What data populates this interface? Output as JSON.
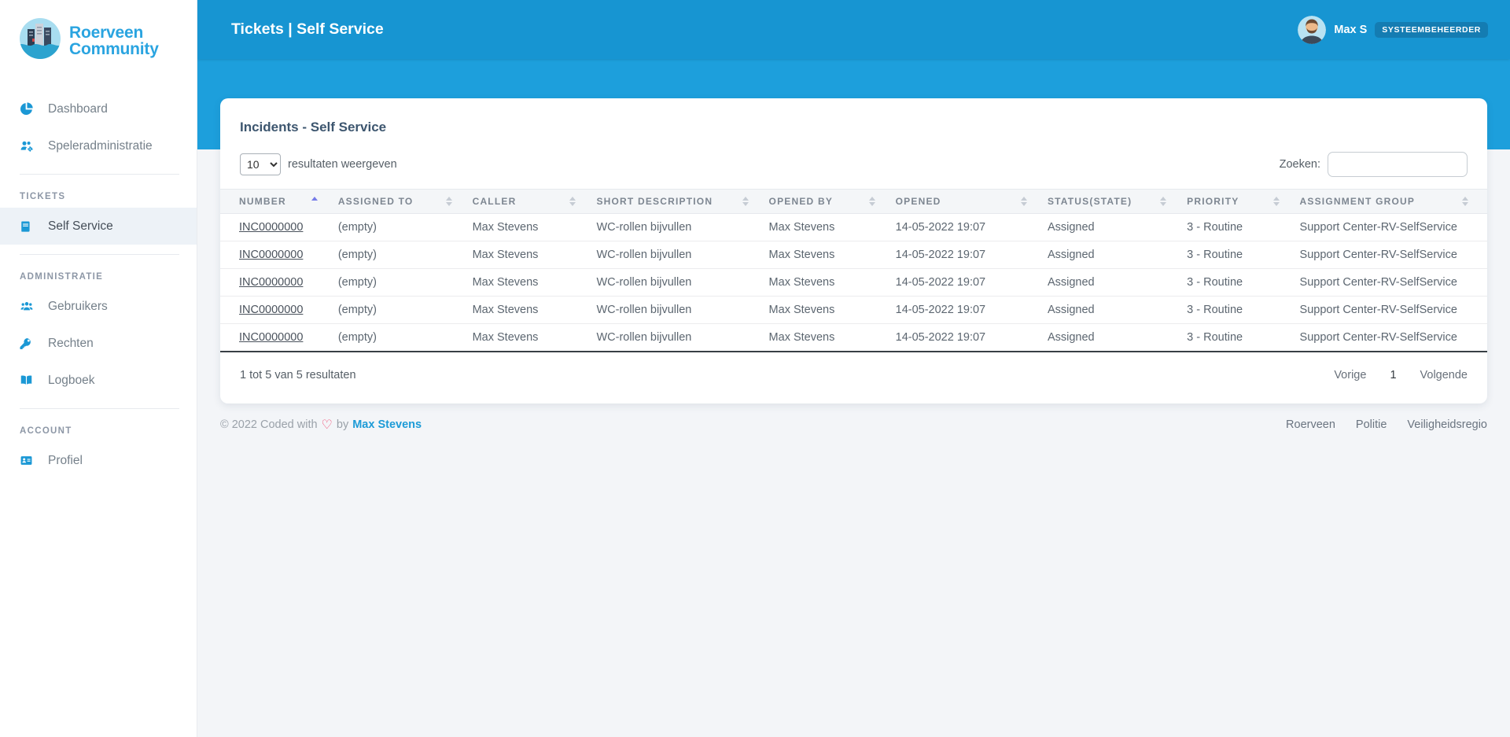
{
  "brand": {
    "line1": "Roerveen",
    "line2": "Community"
  },
  "topbar": {
    "title": "Tickets | Self Service",
    "user_name": "Max S",
    "user_role": "SYSTEEMBEHEERDER"
  },
  "sidebar": {
    "primary": [
      {
        "label": "Dashboard",
        "icon": "pie-chart-icon"
      },
      {
        "label": "Speleradministratie",
        "icon": "users-gear-icon"
      }
    ],
    "sections": [
      {
        "title": "TICKETS",
        "items": [
          {
            "label": "Self Service",
            "icon": "book-icon",
            "active": true
          }
        ]
      },
      {
        "title": "ADMINISTRATIE",
        "items": [
          {
            "label": "Gebruikers",
            "icon": "users-icon"
          },
          {
            "label": "Rechten",
            "icon": "key-icon"
          },
          {
            "label": "Logboek",
            "icon": "open-book-icon"
          }
        ]
      },
      {
        "title": "ACCOUNT",
        "items": [
          {
            "label": "Profiel",
            "icon": "id-card-icon"
          }
        ]
      }
    ]
  },
  "card": {
    "title": "Incidents - Self Service",
    "length_value": "10",
    "length_label": "resultaten weergeven",
    "search_label": "Zoeken:",
    "info": "1 tot 5 van 5 resultaten",
    "pagination": {
      "previous": "Vorige",
      "page": "1",
      "next": "Volgende"
    }
  },
  "table": {
    "keys": [
      "number",
      "assigned_to",
      "caller",
      "short_description",
      "opened_by",
      "opened",
      "status",
      "priority",
      "assignment_group"
    ],
    "columns": [
      {
        "label": "NUMBER",
        "sort": "asc"
      },
      {
        "label": "ASSIGNED TO",
        "sort": "both"
      },
      {
        "label": "CALLER",
        "sort": "both"
      },
      {
        "label": "SHORT DESCRIPTION",
        "sort": "both"
      },
      {
        "label": "OPENED BY",
        "sort": "both"
      },
      {
        "label": "OPENED",
        "sort": "both"
      },
      {
        "label": "STATUS(STATE)",
        "sort": "both"
      },
      {
        "label": "PRIORITY",
        "sort": "both"
      },
      {
        "label": "ASSIGNMENT GROUP",
        "sort": "both"
      }
    ],
    "rows": [
      {
        "number": "INC0000000",
        "assigned_to": "(empty)",
        "caller": "Max Stevens",
        "short_description": "WC-rollen bijvullen",
        "opened_by": "Max Stevens",
        "opened": "14-05-2022 19:07",
        "status": "Assigned",
        "priority": "3 - Routine",
        "assignment_group": "Support Center-RV-SelfService"
      },
      {
        "number": "INC0000000",
        "assigned_to": "(empty)",
        "caller": "Max Stevens",
        "short_description": "WC-rollen bijvullen",
        "opened_by": "Max Stevens",
        "opened": "14-05-2022 19:07",
        "status": "Assigned",
        "priority": "3 - Routine",
        "assignment_group": "Support Center-RV-SelfService"
      },
      {
        "number": "INC0000000",
        "assigned_to": "(empty)",
        "caller": "Max Stevens",
        "short_description": "WC-rollen bijvullen",
        "opened_by": "Max Stevens",
        "opened": "14-05-2022 19:07",
        "status": "Assigned",
        "priority": "3 - Routine",
        "assignment_group": "Support Center-RV-SelfService"
      },
      {
        "number": "INC0000000",
        "assigned_to": "(empty)",
        "caller": "Max Stevens",
        "short_description": "WC-rollen bijvullen",
        "opened_by": "Max Stevens",
        "opened": "14-05-2022 19:07",
        "status": "Assigned",
        "priority": "3 - Routine",
        "assignment_group": "Support Center-RV-SelfService"
      },
      {
        "number": "INC0000000",
        "assigned_to": "(empty)",
        "caller": "Max Stevens",
        "short_description": "WC-rollen bijvullen",
        "opened_by": "Max Stevens",
        "opened": "14-05-2022 19:07",
        "status": "Assigned",
        "priority": "3 - Routine",
        "assignment_group": "Support Center-RV-SelfService"
      }
    ]
  },
  "footer": {
    "copyright_prefix": "© 2022 Coded with",
    "heart": "♡",
    "copyright_middle": "by",
    "author": "Max Stevens",
    "links": [
      "Roerveen",
      "Politie",
      "Veiligheidsregio"
    ]
  },
  "colors": {
    "accent": "#1b98d5",
    "topbar": "#1795d2",
    "band": "#1d9fdc",
    "badge": "#147cb2",
    "link": "#1d9bd7",
    "sort_active": "#767ce8",
    "heart": "#f1476f"
  }
}
